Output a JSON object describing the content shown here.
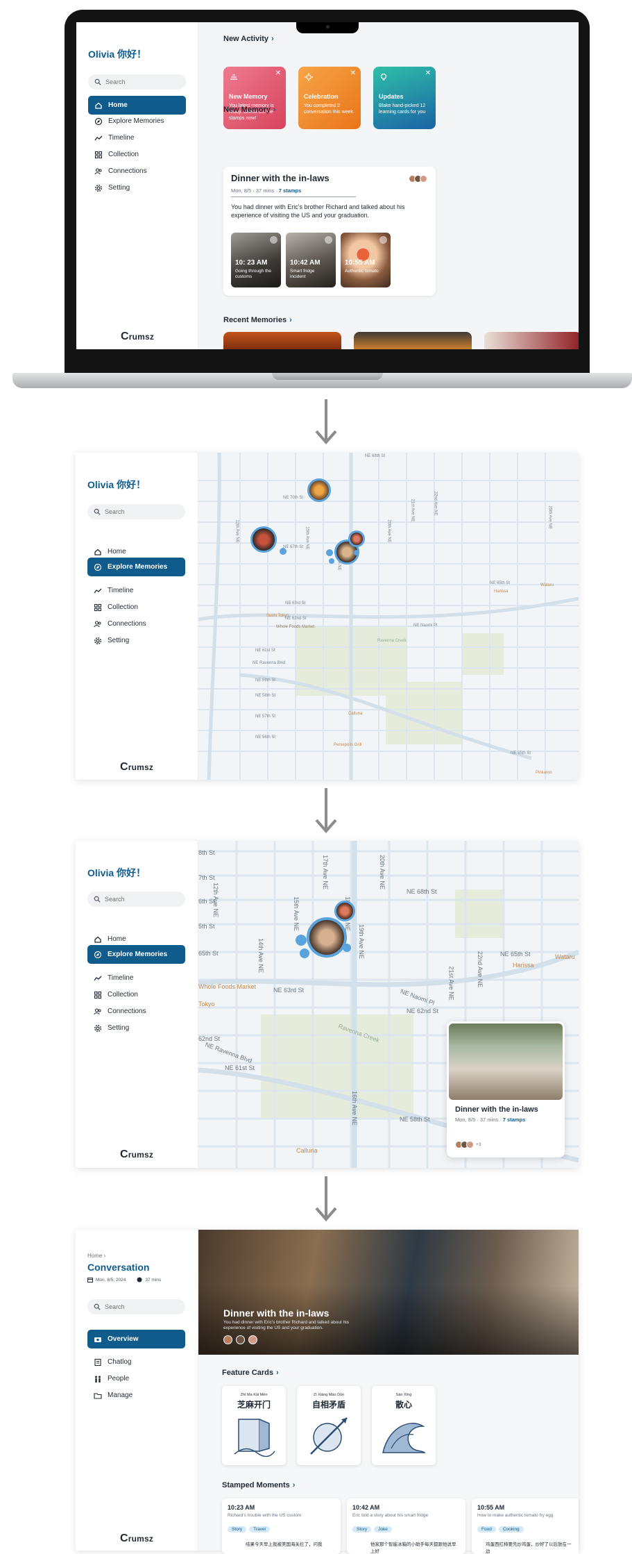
{
  "home": {
    "greeting": "Olivia 你好！",
    "search_placeholder": "Search",
    "nav": [
      "Home",
      "Explore Memories",
      "Timeline",
      "Collection",
      "Connections",
      "Setting"
    ],
    "logo": "rumsz",
    "logo_initial": "C",
    "new_activity_title": "New Activity",
    "activity_cards": [
      {
        "title": "New Memory",
        "desc": "You latest memory is ready. Check out the stamps now!",
        "color_from": "#e9687f",
        "color_to": "#d9475f"
      },
      {
        "title": "Celebration",
        "desc": "You completed 2 conversation this week.",
        "color_from": "#f59a36",
        "color_to": "#e9761d"
      },
      {
        "title": "Updates",
        "desc": "Blake hand-picked 12 learning cards for you",
        "color_from": "#2fb7a8",
        "color_to": "#1e6fa8"
      }
    ],
    "new_memory_title": "New Memory",
    "memory": {
      "title": "Dinner with the in-laws",
      "meta": "Mon, 8/5 · 37 mins ·",
      "stamps": "7 stamps",
      "desc": "You had dinner with Eric's brother Richard and talked about his experience of visiting the US and your graduation."
    },
    "thumbs": [
      {
        "time": "10: 23 AM",
        "label": "Going through the customs"
      },
      {
        "time": "10:42 AM",
        "label": "Smart fridge incident"
      },
      {
        "time": "10:55 AM",
        "label": "Authentic tomato"
      }
    ],
    "recent_title": "Recent Memories"
  },
  "map1": {
    "greeting": "Olivia 你好！",
    "search_placeholder": "Search",
    "nav": [
      "Home",
      "Explore Memories",
      "Timeline",
      "Collection",
      "Connections",
      "Setting"
    ],
    "logo": "rumsz",
    "logo_initial": "C",
    "streets_h": [
      "NE 70th St",
      "NE 68th St",
      "NE 67th St",
      "NE 65th St",
      "NE 63rd St",
      "NE 62nd St",
      "NE 61st St",
      "NE 59th St",
      "NE 58th St",
      "NE 57th St",
      "NE 56th St",
      "NE 55th St"
    ],
    "streets_v": [
      "12th Ave NE",
      "15th Ave NE",
      "17th Ave NE",
      "20th Ave NE",
      "21st Ave NE",
      "22nd Ave NE",
      "25th Ave NE"
    ],
    "places": [
      "Whole Foods Market",
      "Sushi Tokyo",
      "Calluna",
      "Persepolis Grill",
      "Harissa",
      "Wataru",
      "Pinkaroo"
    ],
    "roads": [
      "NE Ravenna Blvd",
      "NE Naomi Pl",
      "Ravenna Creek"
    ]
  },
  "map2": {
    "greeting": "Olivia 你好！",
    "search_placeholder": "Search",
    "nav": [
      "Home",
      "Explore Memories",
      "Timeline",
      "Collection",
      "Connections",
      "Setting"
    ],
    "logo": "rumsz",
    "logo_initial": "C",
    "streets_h": [
      "NE 68th St",
      "NE 65th St",
      "NE 63rd St",
      "NE 62nd St",
      "NE 61st St",
      "NE 58th St",
      "8th St",
      "7th St",
      "6th St",
      "5th St",
      "65th St",
      "62nd St"
    ],
    "streets_v": [
      "12th Ave NE",
      "14th Ave NE",
      "15th Ave NE",
      "16th Ave NE",
      "17th Ave NE",
      "18th Ave NE",
      "19th Ave NE",
      "20th Ave NE",
      "21st Ave NE",
      "22nd Ave NE"
    ],
    "places": [
      "Whole Foods Market",
      "Tokyo",
      "Harissa",
      "Wataru",
      "Calluna"
    ],
    "roads": [
      "NE Ravenna Blvd",
      "NE Naomi Pl",
      "Ravenna Creek"
    ],
    "popup": {
      "title": "Dinner with the in-laws",
      "meta": "Mon, 8/5 · 37 mins ·",
      "stamps": "7 stamps",
      "extra": "+3"
    }
  },
  "conversation": {
    "breadcrumb": "Home",
    "title": "Conversation",
    "date": "Mon, 8/5, 2024",
    "duration": "37 mins",
    "search_placeholder": "Search",
    "nav": [
      "Overview",
      "Chatlog",
      "People",
      "Manage"
    ],
    "logo": "rumsz",
    "logo_initial": "C",
    "hero_title": "Dinner with the in-laws",
    "hero_desc": "You had dinner with Eric's brother Richard and talked about his experience of visiting the US and your graduation.",
    "feature_title": "Feature Cards",
    "features": [
      {
        "pinyin": "Zhī  Ma  Kāi  Mén",
        "hanzi": "芝麻开门"
      },
      {
        "pinyin": "Zì  Xiāng Máo  Dùn",
        "hanzi": "自相矛盾"
      },
      {
        "pinyin": "Sàn  Xīng",
        "hanzi": "散心"
      }
    ],
    "stamped_title": "Stamped Moments",
    "stamps": [
      {
        "time": "10:23 AM",
        "desc": "Richard's trouble with the US custom",
        "tags": [
          "Story",
          "Travel"
        ],
        "text": "结果今天早上我被美国海关拦了，问我"
      },
      {
        "time": "10:42 AM",
        "desc": "Eric told a story about his smart fridge",
        "tags": [
          "Story",
          "Joke"
        ],
        "text": "他家那个智能冰箱的小助手每天都跟他说早上好"
      },
      {
        "time": "10:55 AM",
        "desc": "How to make authentic tomato fry egg",
        "tags": [
          "Food",
          "Cooking"
        ],
        "text": "鸡蛋西红柿要先炒鸡蛋，炒好了以后放在一边"
      }
    ]
  }
}
